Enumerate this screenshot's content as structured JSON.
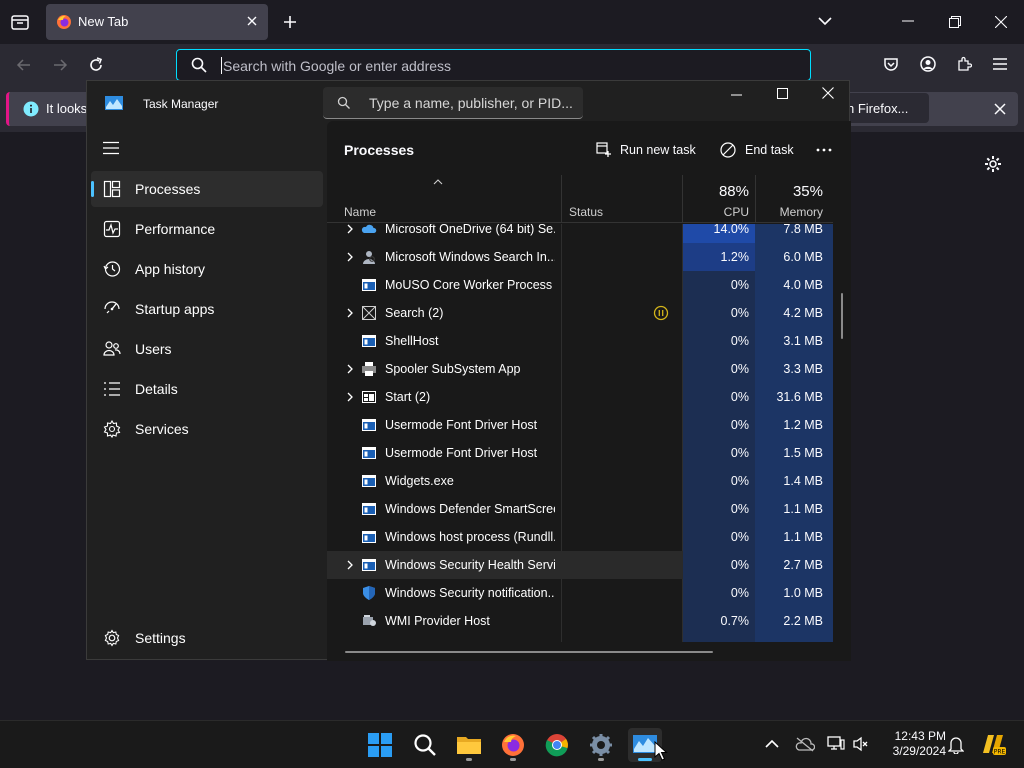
{
  "firefox": {
    "tab_title": "New Tab",
    "url_placeholder": "Search with Google or enter address",
    "notification_left": "It looks",
    "notification_right": "h Firefox..."
  },
  "taskmanager": {
    "title": "Task Manager",
    "search_placeholder": "Type a name, publisher, or PID...",
    "nav": [
      {
        "label": "Processes",
        "icon": "processes-icon"
      },
      {
        "label": "Performance",
        "icon": "performance-icon"
      },
      {
        "label": "App history",
        "icon": "app-history-icon"
      },
      {
        "label": "Startup apps",
        "icon": "startup-apps-icon"
      },
      {
        "label": "Users",
        "icon": "users-icon"
      },
      {
        "label": "Details",
        "icon": "details-icon"
      },
      {
        "label": "Services",
        "icon": "services-icon"
      }
    ],
    "settings_label": "Settings",
    "page_title": "Processes",
    "run_new_task": "Run new task",
    "end_task": "End task",
    "columns": {
      "name": "Name",
      "status": "Status",
      "cpu_pct": "88%",
      "cpu": "CPU",
      "mem_pct": "35%",
      "memory": "Memory"
    },
    "rows": [
      {
        "name": "Microsoft OneDrive (64 bit) Se...",
        "cpu": "14.0%",
        "mem": "7.8 MB",
        "expand": true,
        "icon": "onedrive-icon"
      },
      {
        "name": "Microsoft Windows Search In...",
        "cpu": "1.2%",
        "mem": "6.0 MB",
        "expand": true,
        "icon": "search-indexer-icon"
      },
      {
        "name": "MoUSO Core Worker Process",
        "cpu": "0%",
        "mem": "4.0 MB",
        "expand": false,
        "icon": "process-icon"
      },
      {
        "name": "Search (2)",
        "cpu": "0%",
        "mem": "4.2 MB",
        "expand": true,
        "icon": "search-app-icon",
        "suspended": true
      },
      {
        "name": "ShellHost",
        "cpu": "0%",
        "mem": "3.1 MB",
        "expand": false,
        "icon": "process-icon"
      },
      {
        "name": "Spooler SubSystem App",
        "cpu": "0%",
        "mem": "3.3 MB",
        "expand": true,
        "icon": "printer-icon"
      },
      {
        "name": "Start (2)",
        "cpu": "0%",
        "mem": "31.6 MB",
        "expand": true,
        "icon": "start-app-icon"
      },
      {
        "name": "Usermode Font Driver Host",
        "cpu": "0%",
        "mem": "1.2 MB",
        "expand": false,
        "icon": "process-icon"
      },
      {
        "name": "Usermode Font Driver Host",
        "cpu": "0%",
        "mem": "1.5 MB",
        "expand": false,
        "icon": "process-icon"
      },
      {
        "name": "Widgets.exe",
        "cpu": "0%",
        "mem": "1.4 MB",
        "expand": false,
        "icon": "process-icon"
      },
      {
        "name": "Windows Defender SmartScreen",
        "cpu": "0%",
        "mem": "1.1 MB",
        "expand": false,
        "icon": "process-icon"
      },
      {
        "name": "Windows host process (Rundll...",
        "cpu": "0%",
        "mem": "1.1 MB",
        "expand": false,
        "icon": "process-icon"
      },
      {
        "name": "Windows Security Health Servi...",
        "cpu": "0%",
        "mem": "2.7 MB",
        "expand": true,
        "icon": "process-icon",
        "hover": true
      },
      {
        "name": "Windows Security notification...",
        "cpu": "0%",
        "mem": "1.0 MB",
        "expand": false,
        "icon": "shield-icon"
      },
      {
        "name": "WMI Provider Host",
        "cpu": "0.7%",
        "mem": "2.2 MB",
        "expand": false,
        "icon": "wmi-icon"
      }
    ]
  },
  "taskbar": {
    "time": "12:43 PM",
    "date": "3/29/2024"
  },
  "colors": {
    "accent": "#4cc2ff",
    "cpu_high": "#1f4aa8",
    "cpu_low": "#1c2e52",
    "mem_bg": "#1c3565",
    "suspended": "#d4b51a"
  }
}
